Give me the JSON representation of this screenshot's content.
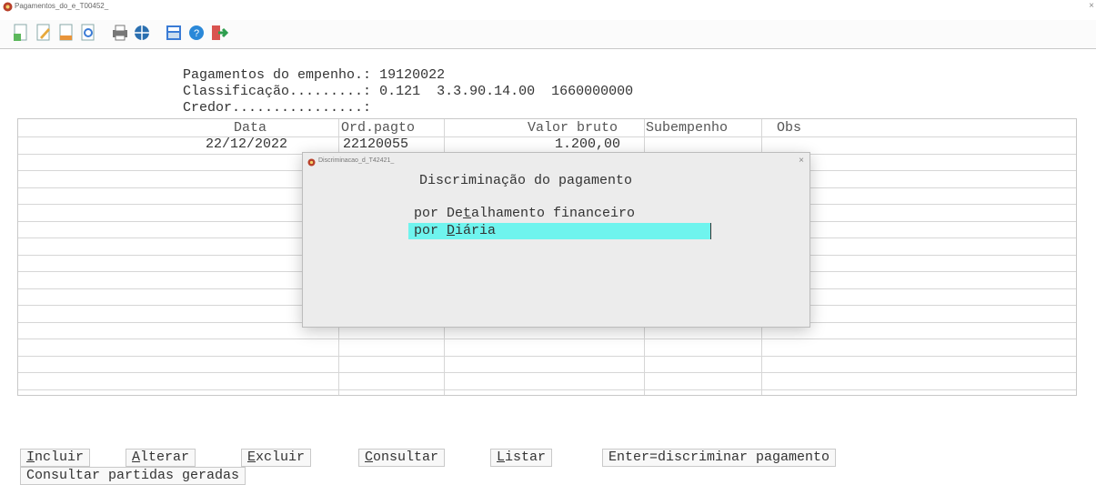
{
  "window": {
    "title": "Pagamentos_do_e_T00452_",
    "close_glyph": "×"
  },
  "toolbar": {
    "icons": [
      "new-document-icon",
      "edit-document-icon",
      "document-icon",
      "preview-icon",
      "print-icon",
      "globe-icon",
      "calculator-icon",
      "help-icon",
      "exit-icon"
    ]
  },
  "header": {
    "line1_label": "Pagamentos do empenho.:",
    "line1_value": "19120022",
    "line2_label": "Classificação.........:",
    "line2_value": "0.121  3.3.90.14.00  1660000000",
    "line3_label": "Credor................:"
  },
  "table": {
    "headers": {
      "data": "Data",
      "ord": "Ord.pagto",
      "valor": "Valor bruto",
      "sub": "Subempenho",
      "obs": "Obs"
    },
    "rows": [
      {
        "data": "22/12/2022",
        "ord": "22120055",
        "valor": "1.200,00",
        "sub": "",
        "obs": ""
      }
    ]
  },
  "dialog": {
    "title": "Discriminacao_d_T42421_",
    "close_glyph": "×",
    "heading": "Discriminação do pagamento",
    "options": [
      {
        "pre": "por De",
        "key": "t",
        "post": "alhamento financeiro",
        "selected": false
      },
      {
        "pre": "por ",
        "key": "D",
        "post": "iária",
        "selected": true
      }
    ]
  },
  "buttons": [
    {
      "key": "I",
      "rest": "ncluir"
    },
    {
      "key": "A",
      "rest": "lterar"
    },
    {
      "key": "E",
      "rest": "xcluir"
    },
    {
      "key": "C",
      "rest": "onsultar"
    },
    {
      "key": "L",
      "rest": "istar"
    },
    {
      "key": "",
      "rest": "Enter=discriminar pagamento"
    }
  ],
  "button2": {
    "pre": "Consultar partidas ",
    "key": "g",
    "post": "eradas"
  }
}
